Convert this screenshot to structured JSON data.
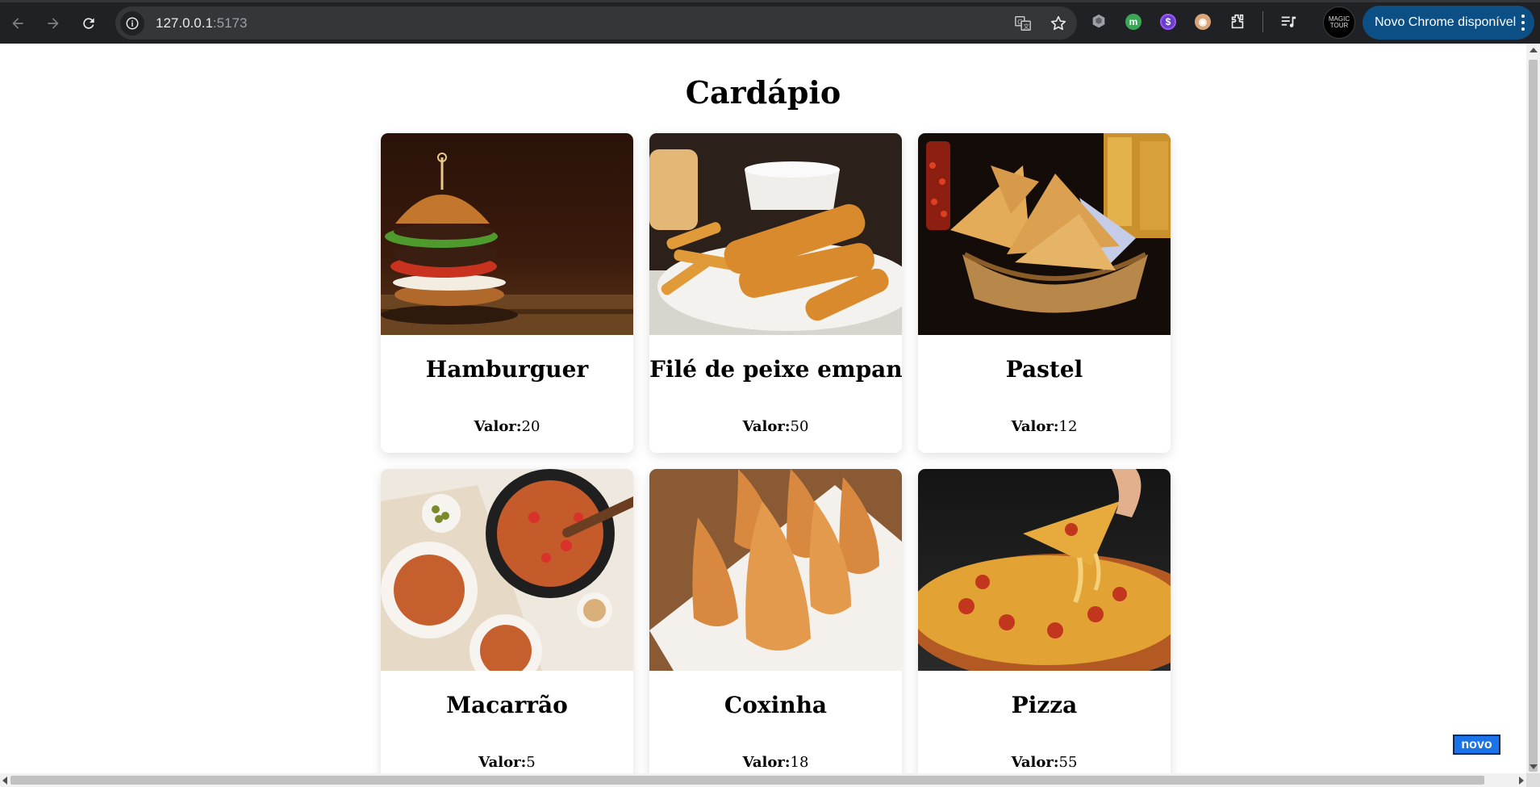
{
  "browser": {
    "url_host": "127.0.0.1",
    "url_port": ":5173",
    "update_label": "Novo Chrome disponível",
    "profile_text": "MAGIC TOUR",
    "icons": [
      "back-icon",
      "forward-icon",
      "reload-icon",
      "site-info-icon",
      "translate-icon",
      "bookmark-star-icon",
      "extensions-icon",
      "reading-list-icon"
    ]
  },
  "page": {
    "title": "Cardápio",
    "price_label": "Valor:",
    "items": [
      {
        "name": "Hamburguer",
        "value": "20"
      },
      {
        "name": "Filé de peixe empanado",
        "value": "50"
      },
      {
        "name": "Pastel",
        "value": "12"
      },
      {
        "name": "Macarrão",
        "value": "5"
      },
      {
        "name": "Coxinha",
        "value": "18"
      },
      {
        "name": "Pizza",
        "value": "55"
      }
    ]
  },
  "overlay": {
    "badge_label": "novo"
  },
  "colors": {
    "chrome_bg": "#202124",
    "omnibox_bg": "#35363a",
    "update_button": "#0b4f85",
    "badge_bg": "#1a73e8"
  }
}
